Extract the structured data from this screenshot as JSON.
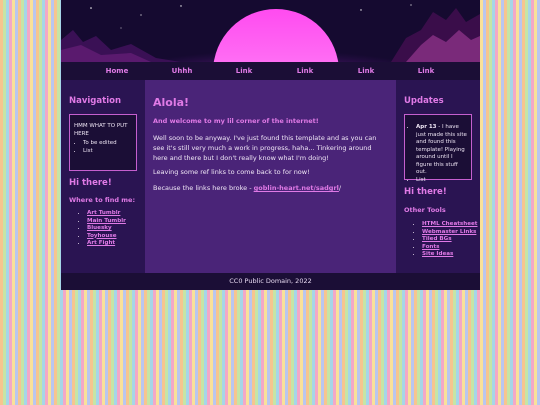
{
  "nav": {
    "items": [
      "Home",
      "Uhhh",
      "Link",
      "Link",
      "Link",
      "Link"
    ]
  },
  "left": {
    "navigation_heading": "Navigation",
    "box_text": "HMM WHAT TO PUT HERE",
    "box_items": [
      "To be edited",
      "List"
    ],
    "hi_heading": "Hi there!",
    "find_heading": "Where to find me:",
    "links": [
      "Art Tumblr",
      "Main Tumblr",
      "Bluesky",
      "Toyhouse",
      "Art Fight"
    ]
  },
  "main": {
    "title": "Alola!",
    "subtitle": "And welcome to my lil corner of the internet!",
    "p1": "Well soon to be anyway. I've just found this template and as you can see it's still very much a work in progress, haha... Tinkering around here and there but I don't really know what I'm doing!",
    "p2": "Leaving some ref links to come back to for now!",
    "p3_prefix": "Because the links here broke - ",
    "p3_link": "goblin-heart.net/sadgrl",
    "p3_suffix": "/"
  },
  "right": {
    "updates_heading": "Updates",
    "update_date": "Apr 13",
    "update_text": " - I have just made this site and found this template! Playing around until I figure this stuff out.",
    "update_item2": "List",
    "hi_heading": "Hi there!",
    "tools_heading": "Other Tools",
    "tools": [
      "HTML Cheatsheet",
      "Webmaster Links",
      "Tiled BGs",
      "Fonts",
      "Site Ideas"
    ]
  },
  "footer": {
    "text": "CC0 Public Domain, 2022"
  },
  "colors": {
    "accent": "#e07ae6",
    "panel": "#2a1452",
    "main": "#4a2478",
    "dark": "#1b0e36"
  }
}
